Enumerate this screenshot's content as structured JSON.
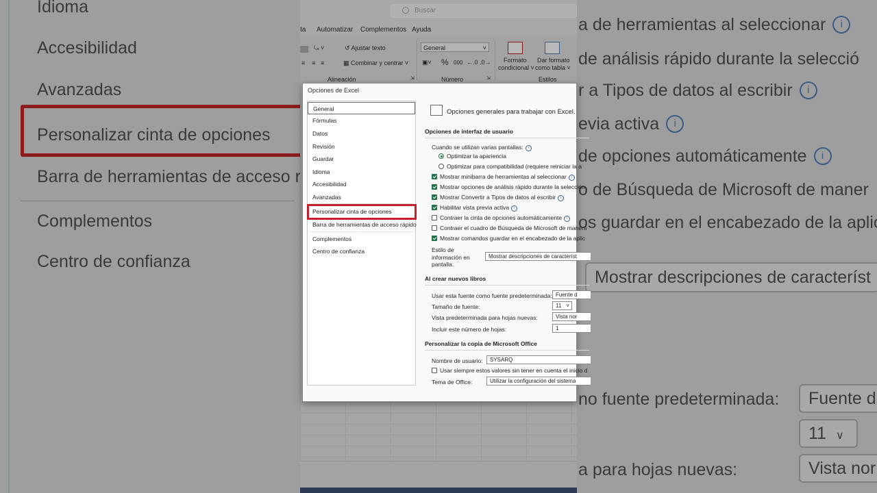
{
  "background_left": {
    "items": [
      "Idioma",
      "Accesibilidad",
      "Avanzadas",
      "Personalizar cinta de opciones",
      "Barra de herramientas de acceso r",
      "Complementos",
      "Centro de confianza"
    ]
  },
  "background_right": {
    "lines": [
      "a de herramientas al seleccionar",
      "de análisis rápido durante la selecció",
      "r a Tipos de datos al escribir",
      "evia activa",
      "de opciones automáticamente",
      "o de Búsqueda de Microsoft de maner",
      "os guardar en el encabezado de la aplic"
    ],
    "tooltip_box": "Mostrar descripciones de característ",
    "font_label": "no fuente predeterminada:",
    "font_box": "Fuente d",
    "size_box": "11",
    "view_label": "a para hojas nuevas:",
    "view_box": "Vista nor"
  },
  "excel": {
    "search_placeholder": "Buscar",
    "menu": [
      "ta",
      "Automatizar",
      "Complementos",
      "Ayuda"
    ],
    "ribbon": {
      "wrap_text": "Ajustar texto",
      "merge_center": "Combinar y centrar",
      "number_format": "General",
      "percent": "%",
      "thousands": "000",
      "cond_format_1": "Formato",
      "cond_format_2": "condicional",
      "table_format_1": "Dar formato",
      "table_format_2": "como tabla",
      "group_alignment": "Alineación",
      "group_number": "Número",
      "group_styles": "Estilos"
    }
  },
  "dialog": {
    "title": "Opciones de Excel",
    "nav": [
      "General",
      "Fórmulas",
      "Datos",
      "Revisión",
      "Guardar",
      "Idioma",
      "Accesibilidad",
      "Avanzadas",
      "Personalizar cinta de opciones",
      "Barra de herramientas de acceso rápido",
      "Complementos",
      "Centro de confianza"
    ],
    "header": "Opciones generales para trabajar con Excel.",
    "ui_section": "Opciones de interfaz de usuario",
    "multi_screens": "Cuando se utilizan varias pantallas:",
    "radio_appearance": "Optimizar la apariencia",
    "radio_compat": "Optimizar para compatibilidad (requiere reiniciar la a",
    "opt_minibar": "Mostrar minibarra de herramientas al seleccionar",
    "opt_quick": "Mostrar opciones de análisis rápido durante la selección",
    "opt_datatypes": "Mostrar Convertir a Tipos de datos al escribir",
    "opt_preview": "Habilitar vista previa activa",
    "opt_collapse": "Contraer la cinta de opciones automáticamente",
    "opt_search": "Contraer el cuadro de Búsqueda de Microsoft de manera",
    "opt_save": "Mostrar comandos guardar en el encabezado de la aplic",
    "tooltip_label_1": "Estilo de",
    "tooltip_label_2": "información en",
    "tooltip_label_3": "pantalla:",
    "tooltip_value": "Mostrar descripciones de característ",
    "new_books_section": "Al crear nuevos libros",
    "font_label": "Usar esta fuente como fuente predeterminada:",
    "font_value": "Fuente d",
    "size_label": "Tamaño de fuente:",
    "size_value": "11",
    "view_label": "Vista predeterminada para hojas nuevas:",
    "view_value": "Vista nor",
    "sheets_label": "Incluir este número de hojas:",
    "sheets_value": "1",
    "office_section": "Personalizar la copia de Microsoft Office",
    "user_label": "Nombre de usuario:",
    "user_value": "SYSARQ",
    "always_values": "Usar siempre estos valores sin tener en cuenta el inicio d",
    "theme_label": "Tema de Office:",
    "theme_value": "Utilizar la configuración del sistema"
  }
}
